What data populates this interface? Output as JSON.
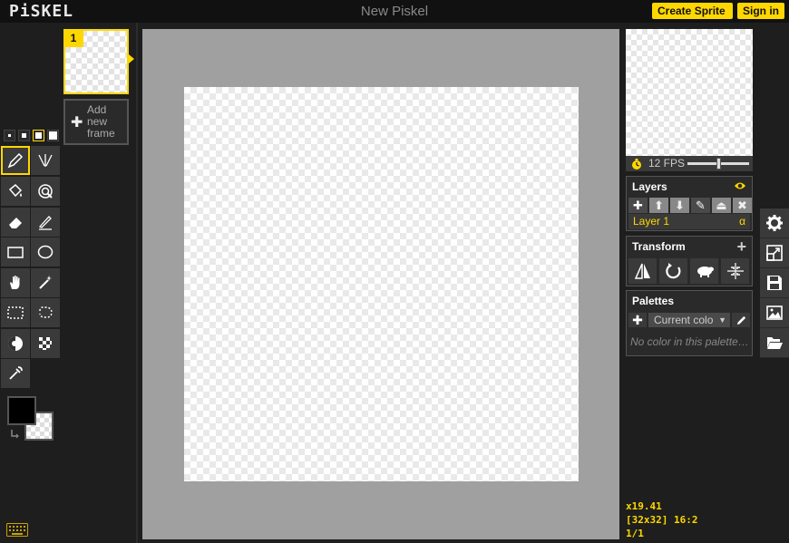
{
  "app": {
    "logo": "PiSKEL",
    "title": "New Piskel"
  },
  "header": {
    "create_label": "Create Sprite",
    "signin_label": "Sign in"
  },
  "frames": {
    "items": [
      {
        "number": "1"
      }
    ],
    "add_label": "Add new frame"
  },
  "preview": {
    "fps_label": "12 FPS",
    "fps_value": 12
  },
  "layers": {
    "title": "Layers",
    "items": [
      {
        "name": "Layer 1",
        "opacity_symbol": "α"
      }
    ]
  },
  "transform": {
    "title": "Transform"
  },
  "palettes": {
    "title": "Palettes",
    "selected": "Current colo",
    "empty_text": "No color in this palette…"
  },
  "status": {
    "cursor": "x19.41",
    "size_ratio": "[32x32] 16:2",
    "frame_count": "1/1"
  },
  "colors": {
    "accent": "#ffd700",
    "primary_color": "#000000",
    "background": "#1e1e1e"
  }
}
